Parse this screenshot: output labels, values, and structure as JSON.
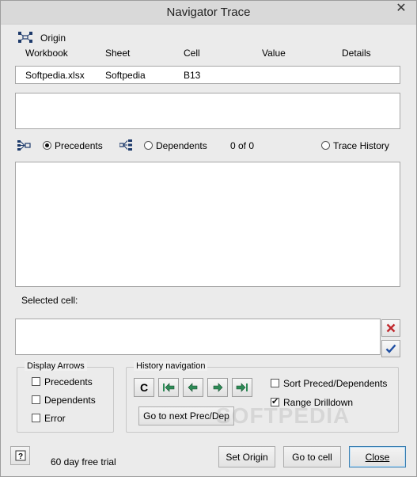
{
  "window": {
    "title": "Navigator Trace",
    "close_glyph": "✕"
  },
  "origin": {
    "label": "Origin",
    "columns": [
      "Workbook",
      "Sheet",
      "Cell",
      "Value",
      "Details"
    ],
    "row": {
      "workbook": "Softpedia.xlsx",
      "sheet": "Softpedia",
      "cell": "B13",
      "value": "",
      "details": ""
    }
  },
  "trace": {
    "precedents_label": "Precedents",
    "dependents_label": "Dependents",
    "count": "0 of 0",
    "history_label": "Trace History",
    "selected_mode": "precedents"
  },
  "selected_cell": {
    "label": "Selected cell:",
    "value": ""
  },
  "display_arrows": {
    "legend": "Display Arrows",
    "items": [
      {
        "label": "Precedents",
        "checked": false
      },
      {
        "label": "Dependents",
        "checked": false
      },
      {
        "label": "Error",
        "checked": false
      }
    ]
  },
  "history_nav": {
    "legend": "History navigation",
    "clear_label": "C",
    "next_label": "Go to next Prec/Dep"
  },
  "options": {
    "sort_label": "Sort Preced/Dependents",
    "sort_checked": false,
    "drilldown_label": "Range Drilldown",
    "drilldown_checked": true
  },
  "footer": {
    "trial_text": "60 day free trial",
    "set_origin": "Set Origin",
    "go_to_cell": "Go to cell",
    "close": "Close"
  },
  "watermark": "SOFTPEDIA",
  "colors": {
    "cancel": "#c0282d",
    "ok": "#1f4fa3",
    "arrow": "#2e8b57"
  },
  "icons": [
    "origin-icon",
    "precedents-icon",
    "dependents-icon",
    "cancel-icon",
    "confirm-icon",
    "help-icon",
    "first-icon",
    "prev-icon",
    "next-icon",
    "last-icon"
  ]
}
